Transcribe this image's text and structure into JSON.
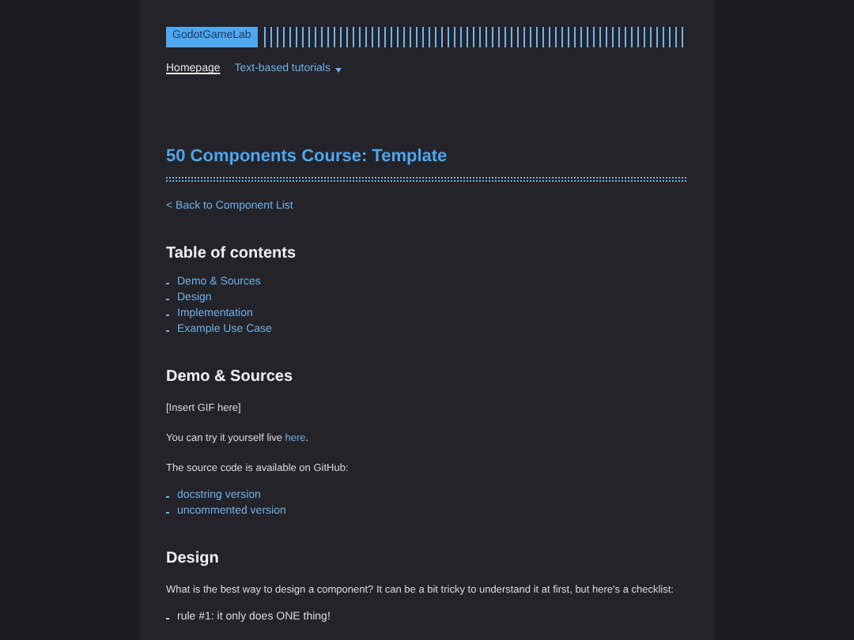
{
  "header": {
    "logo": "GodotGameLab",
    "nav": [
      {
        "label": "Homepage",
        "selected": true,
        "dropdown": false
      },
      {
        "label": "Text-based tutorials",
        "selected": false,
        "dropdown": true
      }
    ]
  },
  "title": "50 Components Course: Template",
  "back_link": "< Back to Component List",
  "blocks": [
    {
      "kind": "heading",
      "text": "Table of contents"
    },
    {
      "kind": "links",
      "items": [
        "Demo & Sources",
        "Design",
        "Implementation",
        "Example Use Case"
      ]
    },
    {
      "kind": "heading",
      "text": "Demo & Sources"
    },
    {
      "kind": "paragraph",
      "text": "[Insert GIF here]"
    },
    {
      "kind": "paragraph",
      "text": "You can try it yourself live ",
      "link": "here",
      "after": "."
    },
    {
      "kind": "paragraph",
      "text": "The source code is available on GitHub:"
    },
    {
      "kind": "links",
      "items": [
        "docstring version",
        "uncommented version"
      ]
    },
    {
      "kind": "heading",
      "text": "Design"
    },
    {
      "kind": "paragraph",
      "text": "What is the best way to design a component? It can be a bit tricky to understand it at first, but here's a checklist:"
    },
    {
      "kind": "bullets",
      "items": [
        "rule #1: it only does ONE thing!"
      ]
    }
  ]
}
